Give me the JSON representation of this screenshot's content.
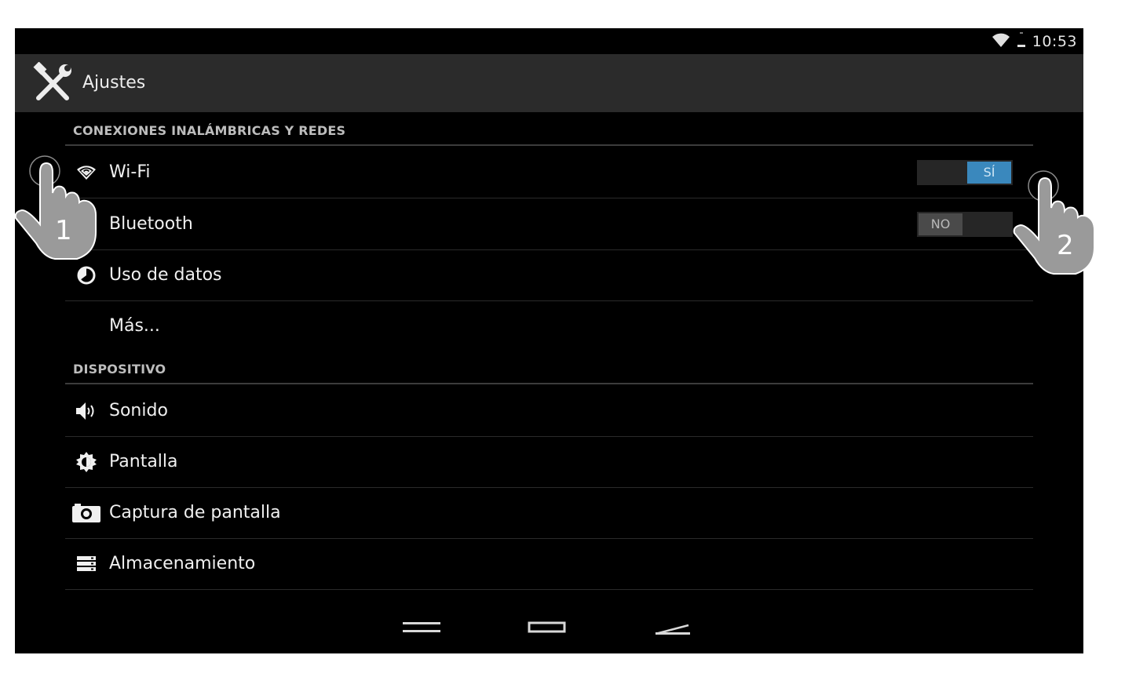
{
  "status_bar": {
    "time": "10:53"
  },
  "action_bar": {
    "title": "Ajustes",
    "icon": "settings-tools-icon"
  },
  "sections": [
    {
      "header": "CONEXIONES INALÁMBRICAS Y REDES"
    },
    {
      "header": "DISPOSITIVO"
    }
  ],
  "wireless": {
    "wifi": {
      "label": "Wi-Fi",
      "icon": "wifi-icon",
      "toggle": "SÍ",
      "state": "on"
    },
    "bluetooth": {
      "label": "Bluetooth",
      "toggle": "NO",
      "state": "off"
    },
    "data_usage": {
      "label": "Uso de datos",
      "icon": "data-usage-icon"
    },
    "more": {
      "label": "Más..."
    }
  },
  "device": {
    "sound": {
      "label": "Sonido",
      "icon": "speaker-icon"
    },
    "display": {
      "label": "Pantalla",
      "icon": "brightness-icon"
    },
    "screenshot": {
      "label": "Captura de pantalla",
      "icon": "camera-icon"
    },
    "storage": {
      "label": "Almacenamiento",
      "icon": "storage-icon"
    }
  },
  "annotations": {
    "step1": "1",
    "step2": "2"
  },
  "colors": {
    "accent": "#3a88bd",
    "background": "#000000",
    "action_bar": "#2b2b2b",
    "hand": "#9a9a9a"
  }
}
